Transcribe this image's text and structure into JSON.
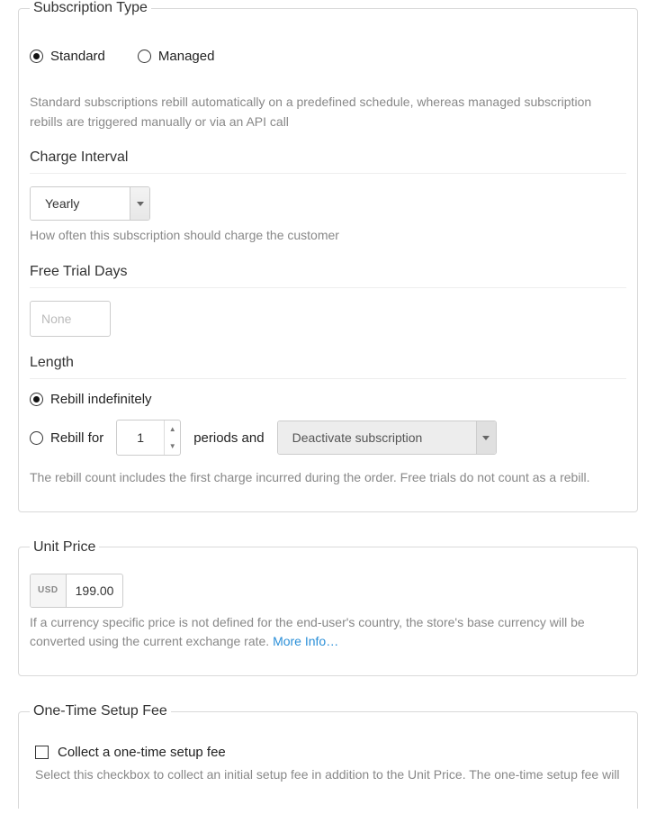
{
  "subscription_type": {
    "legend": "Subscription Type",
    "options": {
      "standard": "Standard",
      "managed": "Managed"
    },
    "selected": "standard",
    "help": "Standard subscriptions rebill automatically on a predefined schedule, whereas managed subscription rebills are triggered manually or via an API call"
  },
  "charge_interval": {
    "label": "Charge Interval",
    "value": "Yearly",
    "help": "How often this subscription should charge the customer"
  },
  "free_trial": {
    "label": "Free Trial Days",
    "placeholder": "None"
  },
  "length": {
    "label": "Length",
    "options": {
      "indefinitely": "Rebill indefinitely",
      "rebill_for_prefix": "Rebill for",
      "periods_and": "periods and"
    },
    "selected": "indefinitely",
    "periods": "1",
    "action": "Deactivate subscription",
    "help": "The rebill count includes the first charge incurred during the order. Free trials do not count as a rebill."
  },
  "unit_price": {
    "legend": "Unit Price",
    "currency": "USD",
    "value": "199.00",
    "help": "If a currency specific price is not defined for the end-user's country, the store's base currency will be converted using the current exchange rate. ",
    "more_info": "More Info…"
  },
  "setup_fee": {
    "legend": "One-Time Setup Fee",
    "checkbox_label": "Collect a one-time setup fee",
    "checked": false,
    "help": "Select this checkbox to collect an initial setup fee in addition to the Unit Price. The one-time setup fee will"
  }
}
